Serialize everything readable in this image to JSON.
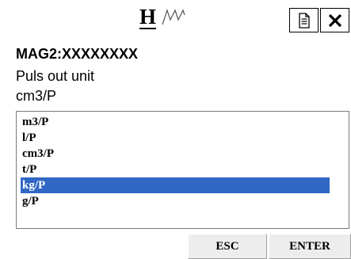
{
  "header": {
    "logo_letter": "H",
    "logo_icon": "waveform-icon",
    "doc_icon": "document-icon",
    "close_icon": "close-icon"
  },
  "device": {
    "name": "MAG2:XXXXXXXX"
  },
  "parameter": {
    "label": "Puls out unit",
    "current_value": "cm3/P"
  },
  "options": {
    "items": [
      "m3/P",
      "l/P",
      "cm3/P",
      "t/P",
      "kg/P",
      "g/P"
    ],
    "selected_index": 4
  },
  "buttons": {
    "esc_label": "ESC",
    "enter_label": "ENTER"
  },
  "colors": {
    "selection": "#3067c4"
  }
}
